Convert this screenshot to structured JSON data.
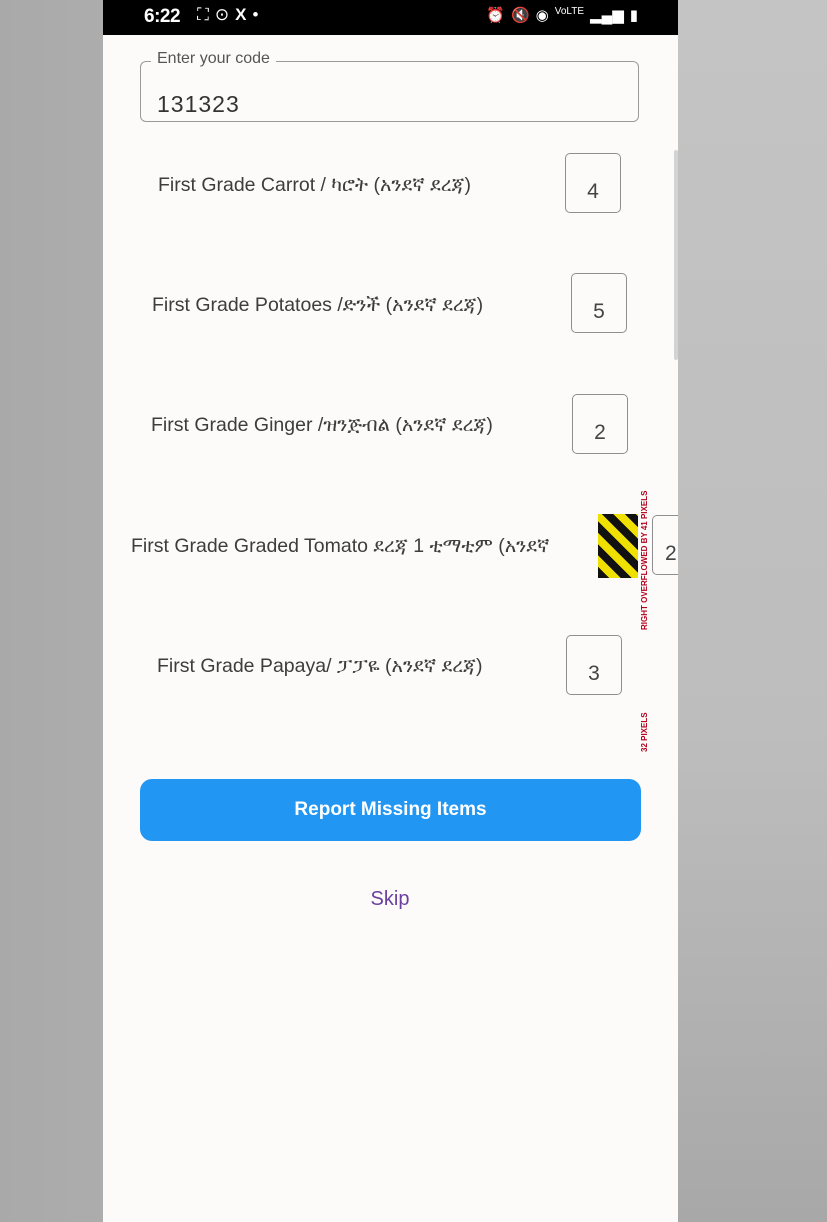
{
  "status_bar": {
    "time": "6:22",
    "left_icons": [
      "screenshot-icon",
      "screen-record-icon",
      "x-app-icon",
      "notification-dot-icon"
    ],
    "right_icons": [
      "alarm-icon",
      "mute-icon",
      "hotspot-icon",
      "volte-icon",
      "signal-icon",
      "battery-icon"
    ]
  },
  "code_field": {
    "label": "Enter your code",
    "value": "131323"
  },
  "items": [
    {
      "label": "First Grade Carrot / ካሮት (አንደኛ ደረጃ)",
      "quantity": "4"
    },
    {
      "label": "First Grade Potatoes /ድንች (አንደኛ ደረጃ)",
      "quantity": "5"
    },
    {
      "label": "First Grade Ginger /ዝንጅብል (አንደኛ ደረጃ)",
      "quantity": "2"
    },
    {
      "label": "First Grade Graded Tomato ደረጃ 1 ቲማቲም (አንደኛ",
      "quantity": "2"
    },
    {
      "label": "First Grade Papaya/ ፓፓዬ (አንደኛ ደረጃ)",
      "quantity": "3"
    }
  ],
  "overflow_warnings": {
    "right_overflow": "RIGHT OVERFLOWED BY 41 PIXELS",
    "small_overflow": "32 PIXELS"
  },
  "report_button": "Report Missing Items",
  "skip_button": "Skip",
  "colors": {
    "primary_blue": "#2196f3",
    "skip_purple": "#6b3fa0",
    "overflow_red": "#b3001b"
  }
}
